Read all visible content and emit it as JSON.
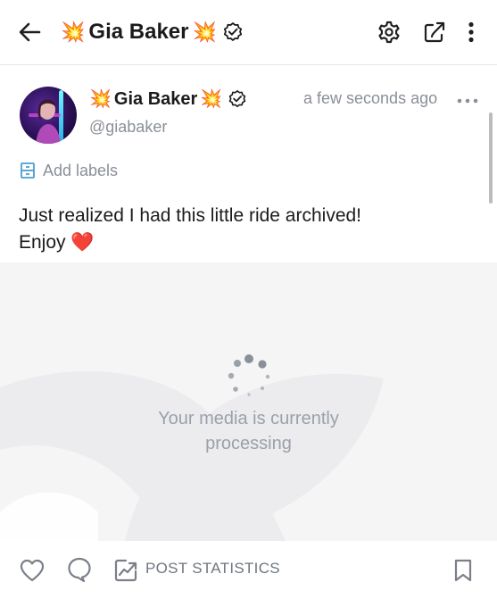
{
  "header": {
    "title": "Gia Baker",
    "title_emoji_left": "💥",
    "title_emoji_right": "💥",
    "icons": [
      "back-arrow-icon",
      "verified-badge-icon",
      "settings-icon",
      "share-icon",
      "more-vertical-icon"
    ]
  },
  "post": {
    "author_name": "Gia Baker",
    "name_emoji_left": "💥",
    "name_emoji_right": "💥",
    "handle": "@giabaker",
    "timestamp": "a few seconds ago",
    "add_labels": "Add labels",
    "text_line1": "Just realized I had this little ride archived!",
    "text_line2": "Enjoy",
    "heart_emoji": "❤️"
  },
  "media": {
    "status_line1": "Your media is currently",
    "status_line2": "processing"
  },
  "footer": {
    "post_statistics": "POST STATISTICS",
    "icons": [
      "like-heart-icon",
      "comment-icon",
      "statistics-icon",
      "bookmark-icon"
    ]
  },
  "colors": {
    "accent": "#4a9fd0",
    "muted_text": "#8a8f98",
    "media_bg": "#f5f5f6",
    "icon_dark": "#1f1f1f"
  }
}
